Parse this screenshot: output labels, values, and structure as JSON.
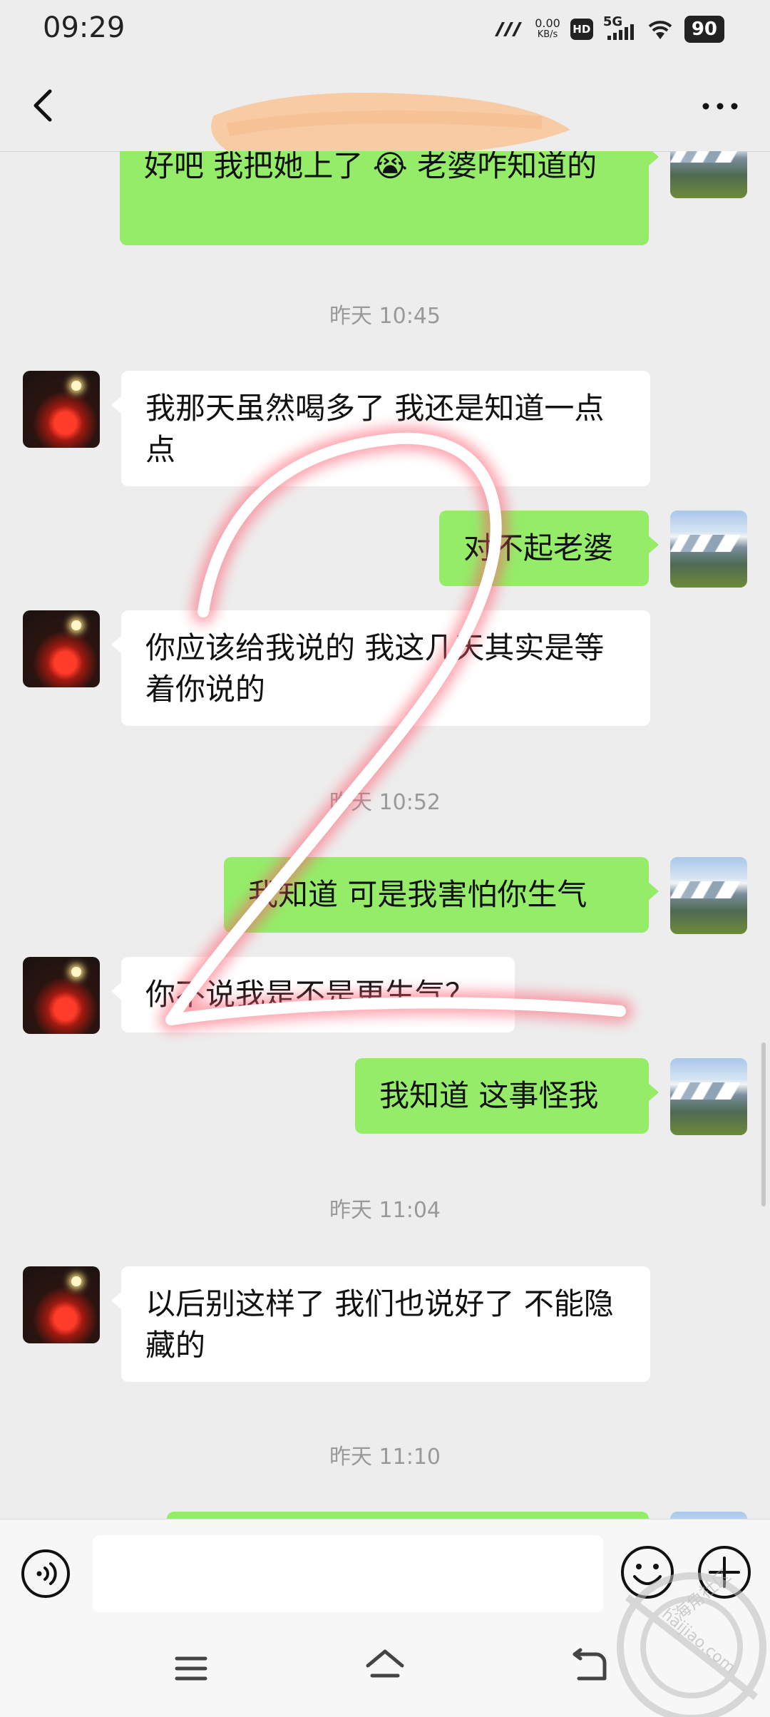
{
  "status_bar": {
    "time": "09:29",
    "net_speed_value": "0.00",
    "net_speed_unit": "KB/s",
    "hd": "HD",
    "signal": "5G",
    "battery": "90"
  },
  "chat": {
    "messages": [
      {
        "side": "right",
        "text": "好吧  我把她上了 😭  老婆咋知道的"
      },
      {
        "side": "time",
        "text": "昨天 10:45"
      },
      {
        "side": "left",
        "text": "我那天虽然喝多了  我还是知道一点点"
      },
      {
        "side": "right",
        "text": "对不起老婆"
      },
      {
        "side": "left",
        "text": "你应该给我说的  我这几天其实是等着你说的"
      },
      {
        "side": "time",
        "text": "昨天 10:52"
      },
      {
        "side": "right",
        "text": "我知道  可是我害怕你生气"
      },
      {
        "side": "left",
        "text": "你不说我是不是更生气？"
      },
      {
        "side": "right",
        "text": "我知道  这事怪我"
      },
      {
        "side": "time",
        "text": "昨天 11:04"
      },
      {
        "side": "left",
        "text": "以后别这样了  我们也说好了  不能隐藏的"
      },
      {
        "side": "time",
        "text": "昨天 11:10"
      }
    ]
  },
  "watermark": {
    "cn_text": "海角社区",
    "url_text": "haijiao.com"
  },
  "colors": {
    "background": "#ededed",
    "outgoing_bubble": "#95ec69",
    "incoming_bubble": "#ffffff"
  }
}
